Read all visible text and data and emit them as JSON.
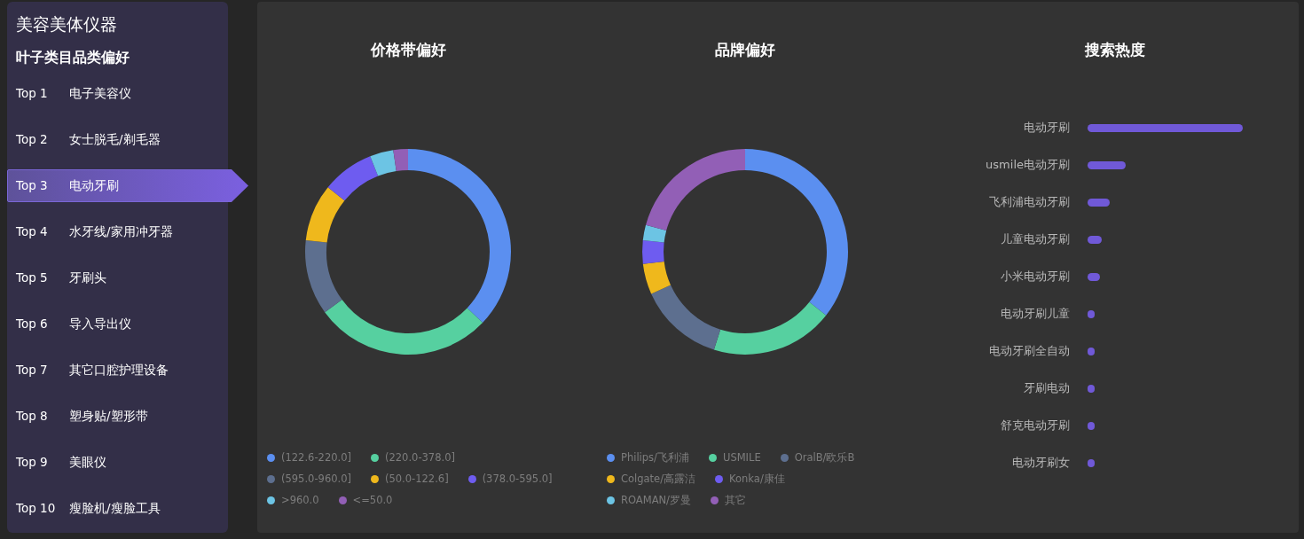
{
  "sidebar": {
    "title": "美容美体仪器",
    "subtitle": "叶子类目品类偏好",
    "items": [
      {
        "rank": "Top 1",
        "name": "电子美容仪",
        "selected": false
      },
      {
        "rank": "Top 2",
        "name": "女士脱毛/剃毛器",
        "selected": false
      },
      {
        "rank": "Top 3",
        "name": "电动牙刷",
        "selected": true
      },
      {
        "rank": "Top 4",
        "name": "水牙线/家用冲牙器",
        "selected": false
      },
      {
        "rank": "Top 5",
        "name": "牙刷头",
        "selected": false
      },
      {
        "rank": "Top 6",
        "name": "导入导出仪",
        "selected": false
      },
      {
        "rank": "Top 7",
        "name": "其它口腔护理设备",
        "selected": false
      },
      {
        "rank": "Top 8",
        "name": "塑身贴/塑形带",
        "selected": false
      },
      {
        "rank": "Top 9",
        "name": "美眼仪",
        "selected": false
      },
      {
        "rank": "Top 10",
        "name": "瘦脸机/瘦脸工具",
        "selected": false
      }
    ]
  },
  "price_band": {
    "title": "价格带偏好",
    "legend_rows": [
      [
        {
          "label": "(122.6-220.0]",
          "color": "#5b8ff0"
        },
        {
          "label": "(220.0-378.0]",
          "color": "#56d0a0"
        }
      ],
      [
        {
          "label": "(595.0-960.0]",
          "color": "#5d6f8f"
        },
        {
          "label": "(50.0-122.6]",
          "color": "#efb81c"
        },
        {
          "label": "(378.0-595.0]",
          "color": "#6e5cf0"
        }
      ],
      [
        {
          "label": ">960.0",
          "color": "#6cc4e4"
        },
        {
          "label": "<=50.0",
          "color": "#925fb6"
        }
      ]
    ]
  },
  "brand": {
    "title": "品牌偏好",
    "legend_rows": [
      [
        {
          "label": "Philips/飞利浦",
          "color": "#5b8ff0"
        },
        {
          "label": "USMILE",
          "color": "#56d0a0"
        },
        {
          "label": "OralB/欧乐B",
          "color": "#5d6f8f"
        }
      ],
      [
        {
          "label": "Colgate/高露洁",
          "color": "#efb81c"
        },
        {
          "label": "Konka/康佳",
          "color": "#6e5cf0"
        }
      ],
      [
        {
          "label": "ROAMAN/罗曼",
          "color": "#6cc4e4"
        },
        {
          "label": "其它",
          "color": "#925fb6"
        }
      ]
    ]
  },
  "search": {
    "title": "搜索热度",
    "terms": [
      "电动牙刷",
      "usmile电动牙刷",
      "飞利浦电动牙刷",
      "儿童电动牙刷",
      "小米电动牙刷",
      "电动牙刷儿童",
      "电动牙刷全自动",
      "牙刷电动",
      "舒克电动牙刷",
      "电动牙刷女"
    ]
  }
}
